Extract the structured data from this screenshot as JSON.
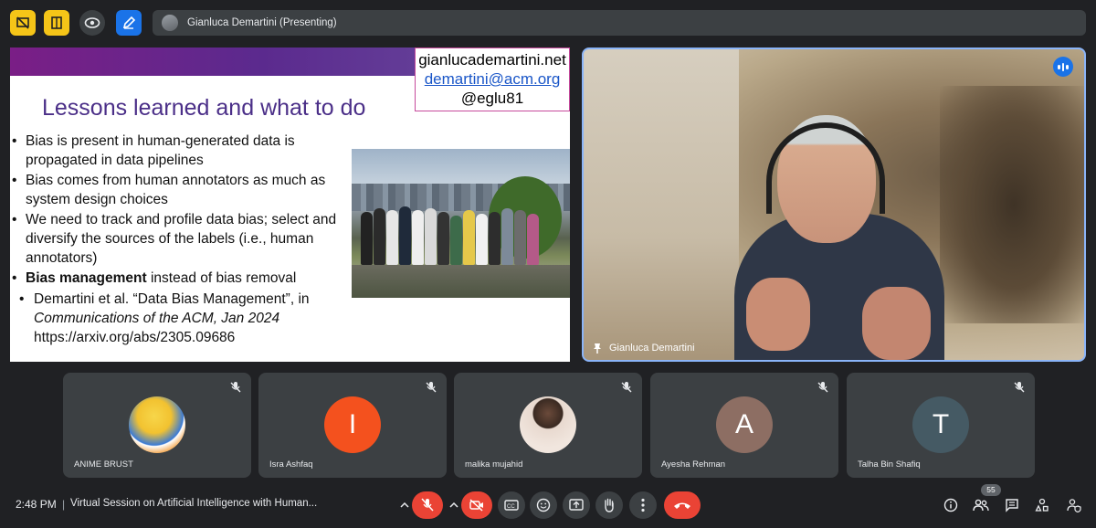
{
  "topbar": {
    "presenter_label": "Gianluca Demartini (Presenting)"
  },
  "slide": {
    "contact": [
      "gianlucademartini.net",
      "demartini@acm.org",
      "@eglu81"
    ],
    "title": "Lessons learned and what to do",
    "bullets": [
      "Bias is present in human-generated data is propagated in data pipelines",
      "Bias comes from human annotators as much as system design choices",
      "We need to track and profile data bias; select and diversify the sources of the labels (i.e., human annotators)"
    ],
    "bullet4_bold": "Bias management",
    "bullet4_rest": " instead of bias removal",
    "ref_author": "Demartini et al. “Data Bias Management”, in",
    "ref_journal": "Communications of the ACM, Jan 2024",
    "ref_url": "https://arxiv.org/abs/2305.09686"
  },
  "speaker": {
    "name": "Gianluca Demartini"
  },
  "participants": [
    {
      "name": "ANIME BRUST",
      "initial": "",
      "color": "#f2c230"
    },
    {
      "name": "Isra Ashfaq",
      "initial": "I",
      "color": "#f4511e"
    },
    {
      "name": "malika mujahid",
      "initial": "",
      "color": "#e8d9cf"
    },
    {
      "name": "Ayesha Rehman",
      "initial": "A",
      "color": "#8d6e63"
    },
    {
      "name": "Talha Bin Shafiq",
      "initial": "T",
      "color": "#455a64"
    }
  ],
  "bottombar": {
    "time": "2:48 PM",
    "separator": "|",
    "meeting_title": "Virtual Session on Artificial Intelligence with Human...",
    "participant_count": "55"
  },
  "colors": {
    "accent_blue": "#1a73e8",
    "end_call_red": "#ea4335",
    "slide_title_purple": "#4b2f88",
    "tile_bg": "#3c4043",
    "bg": "#202124"
  },
  "icons": [
    "present-off-icon",
    "whiteboard-icon",
    "eye-icon",
    "pencil-icon",
    "mic-off-icon",
    "camera-off-icon",
    "captions-icon",
    "emoji-icon",
    "present-icon",
    "raise-hand-icon",
    "more-icon",
    "end-call-icon",
    "info-icon",
    "people-icon",
    "chat-icon",
    "activities-icon",
    "host-controls-icon",
    "pin-icon",
    "chevron-up-icon"
  ]
}
